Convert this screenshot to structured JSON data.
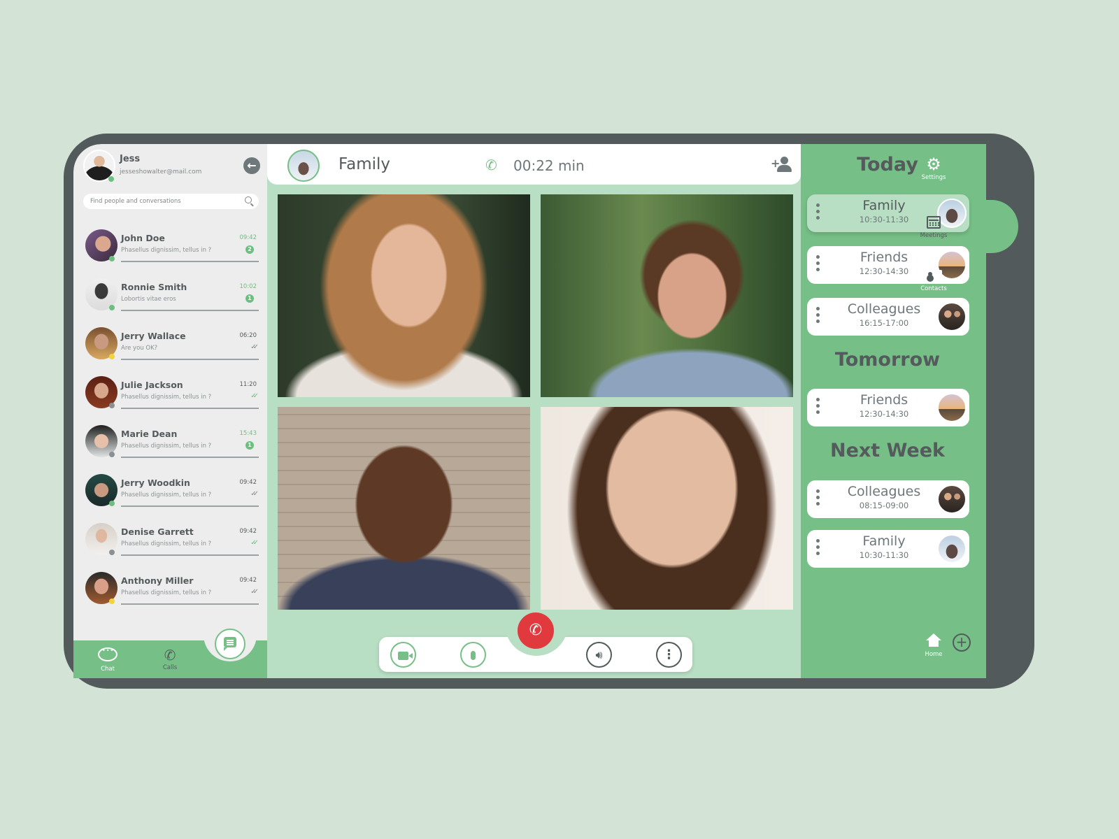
{
  "profile": {
    "name": "Jess",
    "email": "jesseshowalter@mail.com",
    "status": "online"
  },
  "search": {
    "placeholder": "Find people and conversations"
  },
  "contacts": [
    {
      "name": "John Doe",
      "message": "Phasellus dignissim, tellus in ?",
      "time": "09:42",
      "unread": "2",
      "status": "online",
      "read": null
    },
    {
      "name": "Ronnie Smith",
      "message": "Lobortis vitae eros",
      "time": "10:02",
      "unread": "1",
      "status": "online",
      "read": null
    },
    {
      "name": "Jerry Wallace",
      "message": "Are you OK?",
      "time": "06:20",
      "unread": null,
      "status": "away",
      "read": false
    },
    {
      "name": "Julie Jackson",
      "message": "Phasellus dignissim, tellus in ?",
      "time": "11:20",
      "unread": null,
      "status": "offline",
      "read": true
    },
    {
      "name": "Marie Dean",
      "message": "Phasellus dignissim, tellus in ?",
      "time": "15:43",
      "unread": "1",
      "status": "offline",
      "read": null
    },
    {
      "name": "Jerry Woodkin",
      "message": "Phasellus dignissim, tellus in ?",
      "time": "09:42",
      "unread": null,
      "status": "online",
      "read": false
    },
    {
      "name": "Denise Garrett",
      "message": "Phasellus dignissim, tellus in ?",
      "time": "09:42",
      "unread": null,
      "status": "offline",
      "read": true
    },
    {
      "name": "Anthony Miller",
      "message": "Phasellus dignissim, tellus in ?",
      "time": "09:42",
      "unread": null,
      "status": "away",
      "read": false
    }
  ],
  "bottom_nav": {
    "chat_label": "Chat",
    "calls_label": "Calls",
    "active": "Chat"
  },
  "call": {
    "group_name": "Family",
    "duration": "00:22 min",
    "participants": [
      "participant-1",
      "participant-2",
      "participant-3",
      "participant-4"
    ]
  },
  "controls": {
    "video_icon": "video-camera-icon",
    "mic_icon": "microphone-icon",
    "end_call_icon": "phone-hangup-icon",
    "speaker_icon": "speaker-icon",
    "more_icon": "more-vertical-icon"
  },
  "schedule": {
    "sections": [
      {
        "title": "Today",
        "meetings": [
          {
            "name": "Family",
            "time": "10:30-11:30",
            "avatar": "family",
            "active": true
          },
          {
            "name": "Friends",
            "time": "12:30-14:30",
            "avatar": "friends",
            "active": false
          },
          {
            "name": "Colleagues",
            "time": "16:15-17:00",
            "avatar": "colleagues",
            "active": false
          }
        ]
      },
      {
        "title": "Tomorrow",
        "meetings": [
          {
            "name": "Friends",
            "time": "12:30-14:30",
            "avatar": "friends",
            "active": false
          }
        ]
      },
      {
        "title": "Next Week",
        "meetings": [
          {
            "name": "Colleagues",
            "time": "08:15-09:00",
            "avatar": "colleagues",
            "active": false
          },
          {
            "name": "Family",
            "time": "10:30-11:30",
            "avatar": "family",
            "active": false
          }
        ]
      }
    ]
  },
  "rail": {
    "settings_label": "Settings",
    "meetings_label": "Meetings",
    "contacts_label": "Contacts",
    "home_label": "Home",
    "active": "Meetings"
  },
  "colors": {
    "background": "#d3e3d6",
    "frame": "#525a5c",
    "accent": "#76bf87",
    "accent_light": "#b8dec4",
    "end_call": "#e03a3e",
    "text": "#555b5d"
  }
}
